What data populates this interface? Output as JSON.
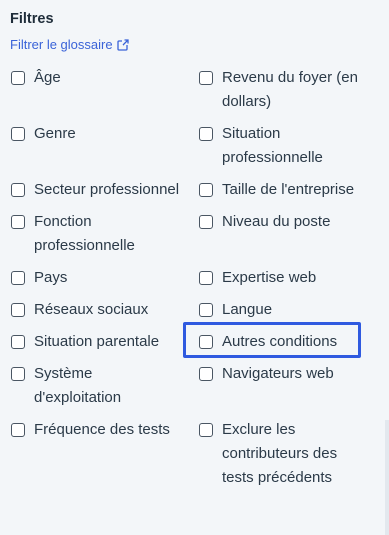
{
  "filters": {
    "title": "Filtres",
    "glossary_link": "Filtrer le glossaire",
    "left_column": [
      {
        "label": "Âge"
      },
      {
        "label": "Genre"
      },
      {
        "label": "Secteur professionnel"
      },
      {
        "label": "Fonction professionnelle"
      },
      {
        "label": "Pays"
      },
      {
        "label": "Réseaux sociaux"
      },
      {
        "label": "Situation parentale"
      },
      {
        "label": "Système d'exploitation"
      },
      {
        "label": "Fréquence des tests"
      }
    ],
    "right_column": [
      {
        "label": "Revenu du foyer (en dollars)"
      },
      {
        "label": "Situation professionnelle"
      },
      {
        "label": "Taille de l'entreprise"
      },
      {
        "label": "Niveau du poste"
      },
      {
        "label": "Expertise web"
      },
      {
        "label": "Langue"
      },
      {
        "label": "Autres conditions"
      },
      {
        "label": "Navigateurs web"
      },
      {
        "label": "Exclure les contributeurs des tests précédents"
      }
    ],
    "highlight_color": "#2f5ae0",
    "link_color": "#3a63d8",
    "icons": {
      "external_link": "external-link-icon"
    }
  }
}
